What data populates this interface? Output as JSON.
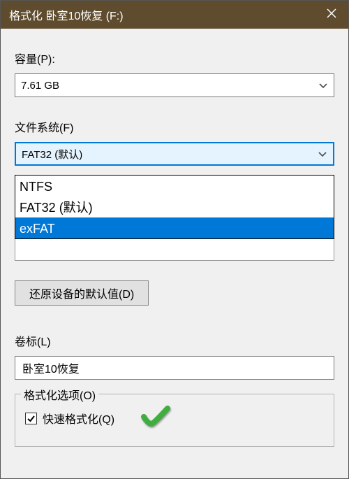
{
  "title": "格式化 卧室10恢复 (F:)",
  "capacity": {
    "label": "容量(P):",
    "value": "7.61 GB"
  },
  "filesystem": {
    "label": "文件系统(F)",
    "selected_value": "FAT32 (默认)",
    "open": true,
    "options": [
      "NTFS",
      "FAT32 (默认)",
      "exFAT"
    ],
    "highlighted_index": 2
  },
  "restore_defaults_button": "还原设备的默认值(D)",
  "volume_label": {
    "label": "卷标(L)",
    "value": "卧室10恢复"
  },
  "format_options": {
    "legend": "格式化选项(O)",
    "quick_format": {
      "label": "快速格式化(Q)",
      "checked": true
    }
  }
}
